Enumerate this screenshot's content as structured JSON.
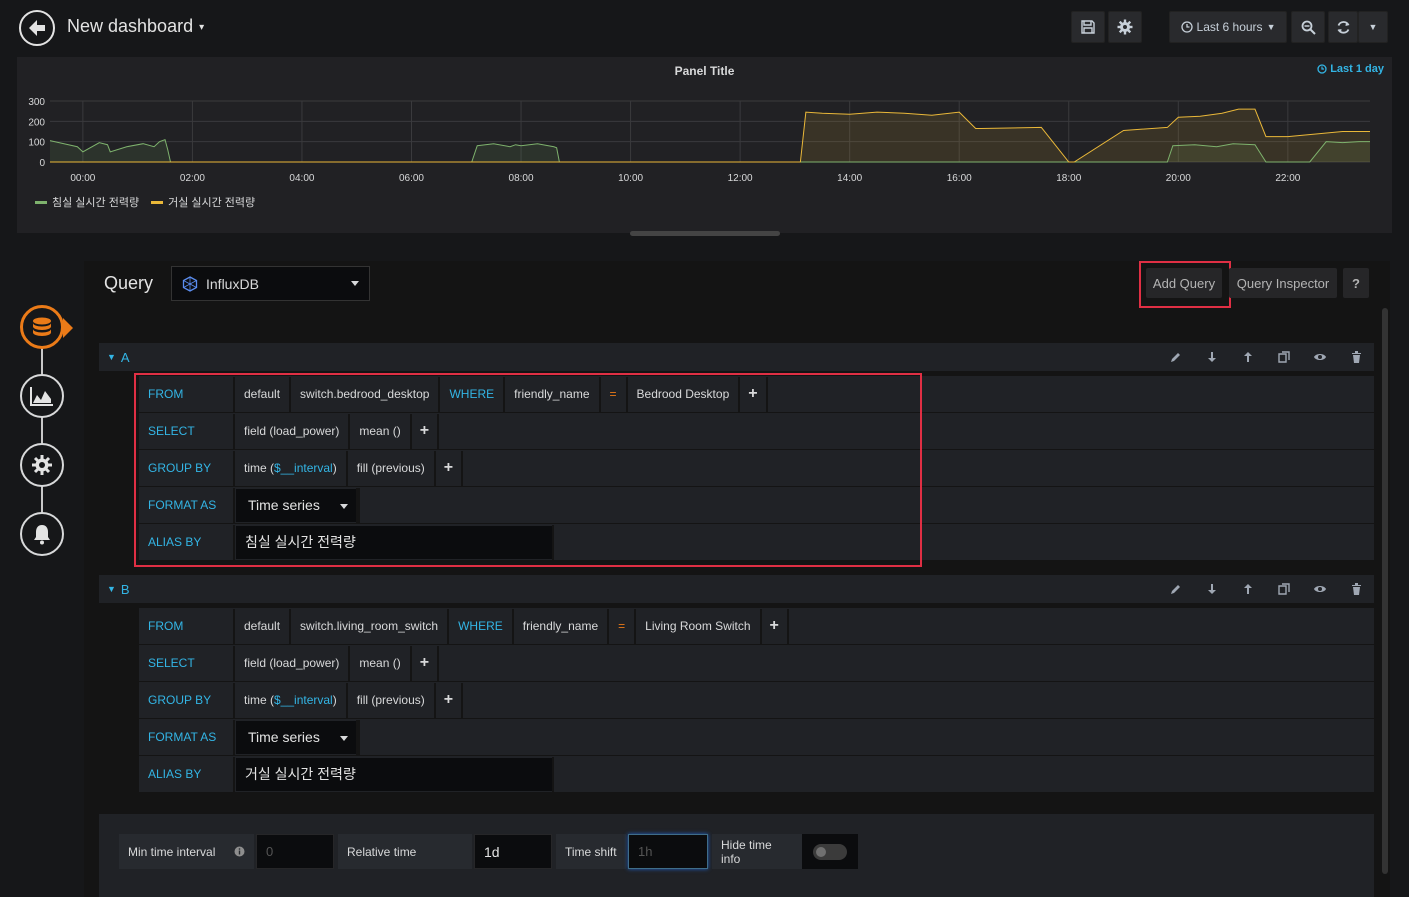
{
  "navbar": {
    "title": "New dashboard",
    "time_range": "Last 6 hours"
  },
  "panel": {
    "title": "Panel Title",
    "time_override": "Last 1 day",
    "legend": [
      {
        "label": "침실 실시간 전력량",
        "color": "#7eb26d"
      },
      {
        "label": "거실 실시간 전력량",
        "color": "#eab839"
      }
    ]
  },
  "chart_data": {
    "type": "area",
    "title": "Panel Title",
    "xlabel": "",
    "ylabel": "",
    "y_ticks": [
      "300",
      "200",
      "100",
      "0"
    ],
    "x_ticks": [
      "00:00",
      "02:00",
      "04:00",
      "06:00",
      "08:00",
      "10:00",
      "12:00",
      "14:00",
      "16:00",
      "18:00",
      "20:00",
      "22:00"
    ],
    "ylim": [
      0,
      300
    ],
    "xlim_hours": [
      -0.6,
      23.5
    ],
    "grid": true,
    "legend_position": "bottom-left",
    "series": [
      {
        "name": "침실 실시간 전력량",
        "color": "#7eb26d",
        "x": [
          -0.6,
          -0.1,
          0.0,
          0.3,
          0.45,
          0.5,
          0.8,
          1.1,
          1.3,
          1.4,
          1.5,
          1.55,
          1.6,
          7.1,
          7.2,
          7.5,
          7.8,
          7.9,
          8.0,
          8.3,
          8.6,
          8.65,
          8.7,
          19.8,
          19.9,
          20.3,
          20.7,
          21.0,
          21.4,
          21.6,
          22.4,
          22.7,
          23.0,
          23.3,
          23.5
        ],
        "y": [
          105,
          75,
          50,
          95,
          85,
          50,
          75,
          90,
          75,
          100,
          110,
          60,
          0,
          0,
          80,
          90,
          75,
          85,
          80,
          90,
          75,
          70,
          0,
          0,
          80,
          85,
          75,
          90,
          85,
          0,
          0,
          100,
          95,
          100,
          100
        ]
      },
      {
        "name": "거실 실시간 전력량",
        "color": "#eab839",
        "x": [
          -0.6,
          13.1,
          13.2,
          13.5,
          14.0,
          14.5,
          15.0,
          15.5,
          16.0,
          16.3,
          16.4,
          17.5,
          18.0,
          18.1,
          19.0,
          19.8,
          20.0,
          20.4,
          20.8,
          21.1,
          21.4,
          21.6,
          22.0,
          23.0,
          23.5
        ],
        "y": [
          0,
          0,
          245,
          240,
          235,
          245,
          240,
          230,
          245,
          165,
          165,
          170,
          0,
          0,
          155,
          170,
          220,
          225,
          240,
          260,
          260,
          125,
          125,
          150,
          150
        ]
      }
    ]
  },
  "editor": {
    "query_label": "Query",
    "datasource": "InfluxDB",
    "add_query": "Add Query",
    "query_inspector": "Query Inspector",
    "help": "?",
    "queries": [
      {
        "letter": "A",
        "from_kw": "FROM",
        "policy": "default",
        "measurement": "switch.bedrood_desktop",
        "where_kw": "WHERE",
        "tag_key": "friendly_name",
        "operator": "=",
        "tag_value": "Bedrood Desktop",
        "select_kw": "SELECT",
        "field": "field (load_power)",
        "agg": "mean ()",
        "groupby_kw": "GROUP BY",
        "time_prefix": "time (",
        "time_var": "$__interval",
        "time_suffix": ")",
        "fill": "fill (previous)",
        "format_kw": "FORMAT AS",
        "format": "Time series",
        "alias_kw": "ALIAS BY",
        "alias": "침실 실시간 전력량"
      },
      {
        "letter": "B",
        "from_kw": "FROM",
        "policy": "default",
        "measurement": "switch.living_room_switch",
        "where_kw": "WHERE",
        "tag_key": "friendly_name",
        "operator": "=",
        "tag_value": "Living Room Switch",
        "select_kw": "SELECT",
        "field": "field (load_power)",
        "agg": "mean ()",
        "groupby_kw": "GROUP BY",
        "time_prefix": "time (",
        "time_var": "$__interval",
        "time_suffix": ")",
        "fill": "fill (previous)",
        "format_kw": "FORMAT AS",
        "format": "Time series",
        "alias_kw": "ALIAS BY",
        "alias": "거실 실시간 전력량"
      }
    ],
    "options": {
      "min_interval_label": "Min time interval",
      "min_interval_placeholder": "0",
      "relative_time_label": "Relative time",
      "relative_time_value": "1d",
      "time_shift_label": "Time shift",
      "time_shift_placeholder": "1h",
      "hide_time_info_label": "Hide time info",
      "hide_time_info": false
    }
  }
}
